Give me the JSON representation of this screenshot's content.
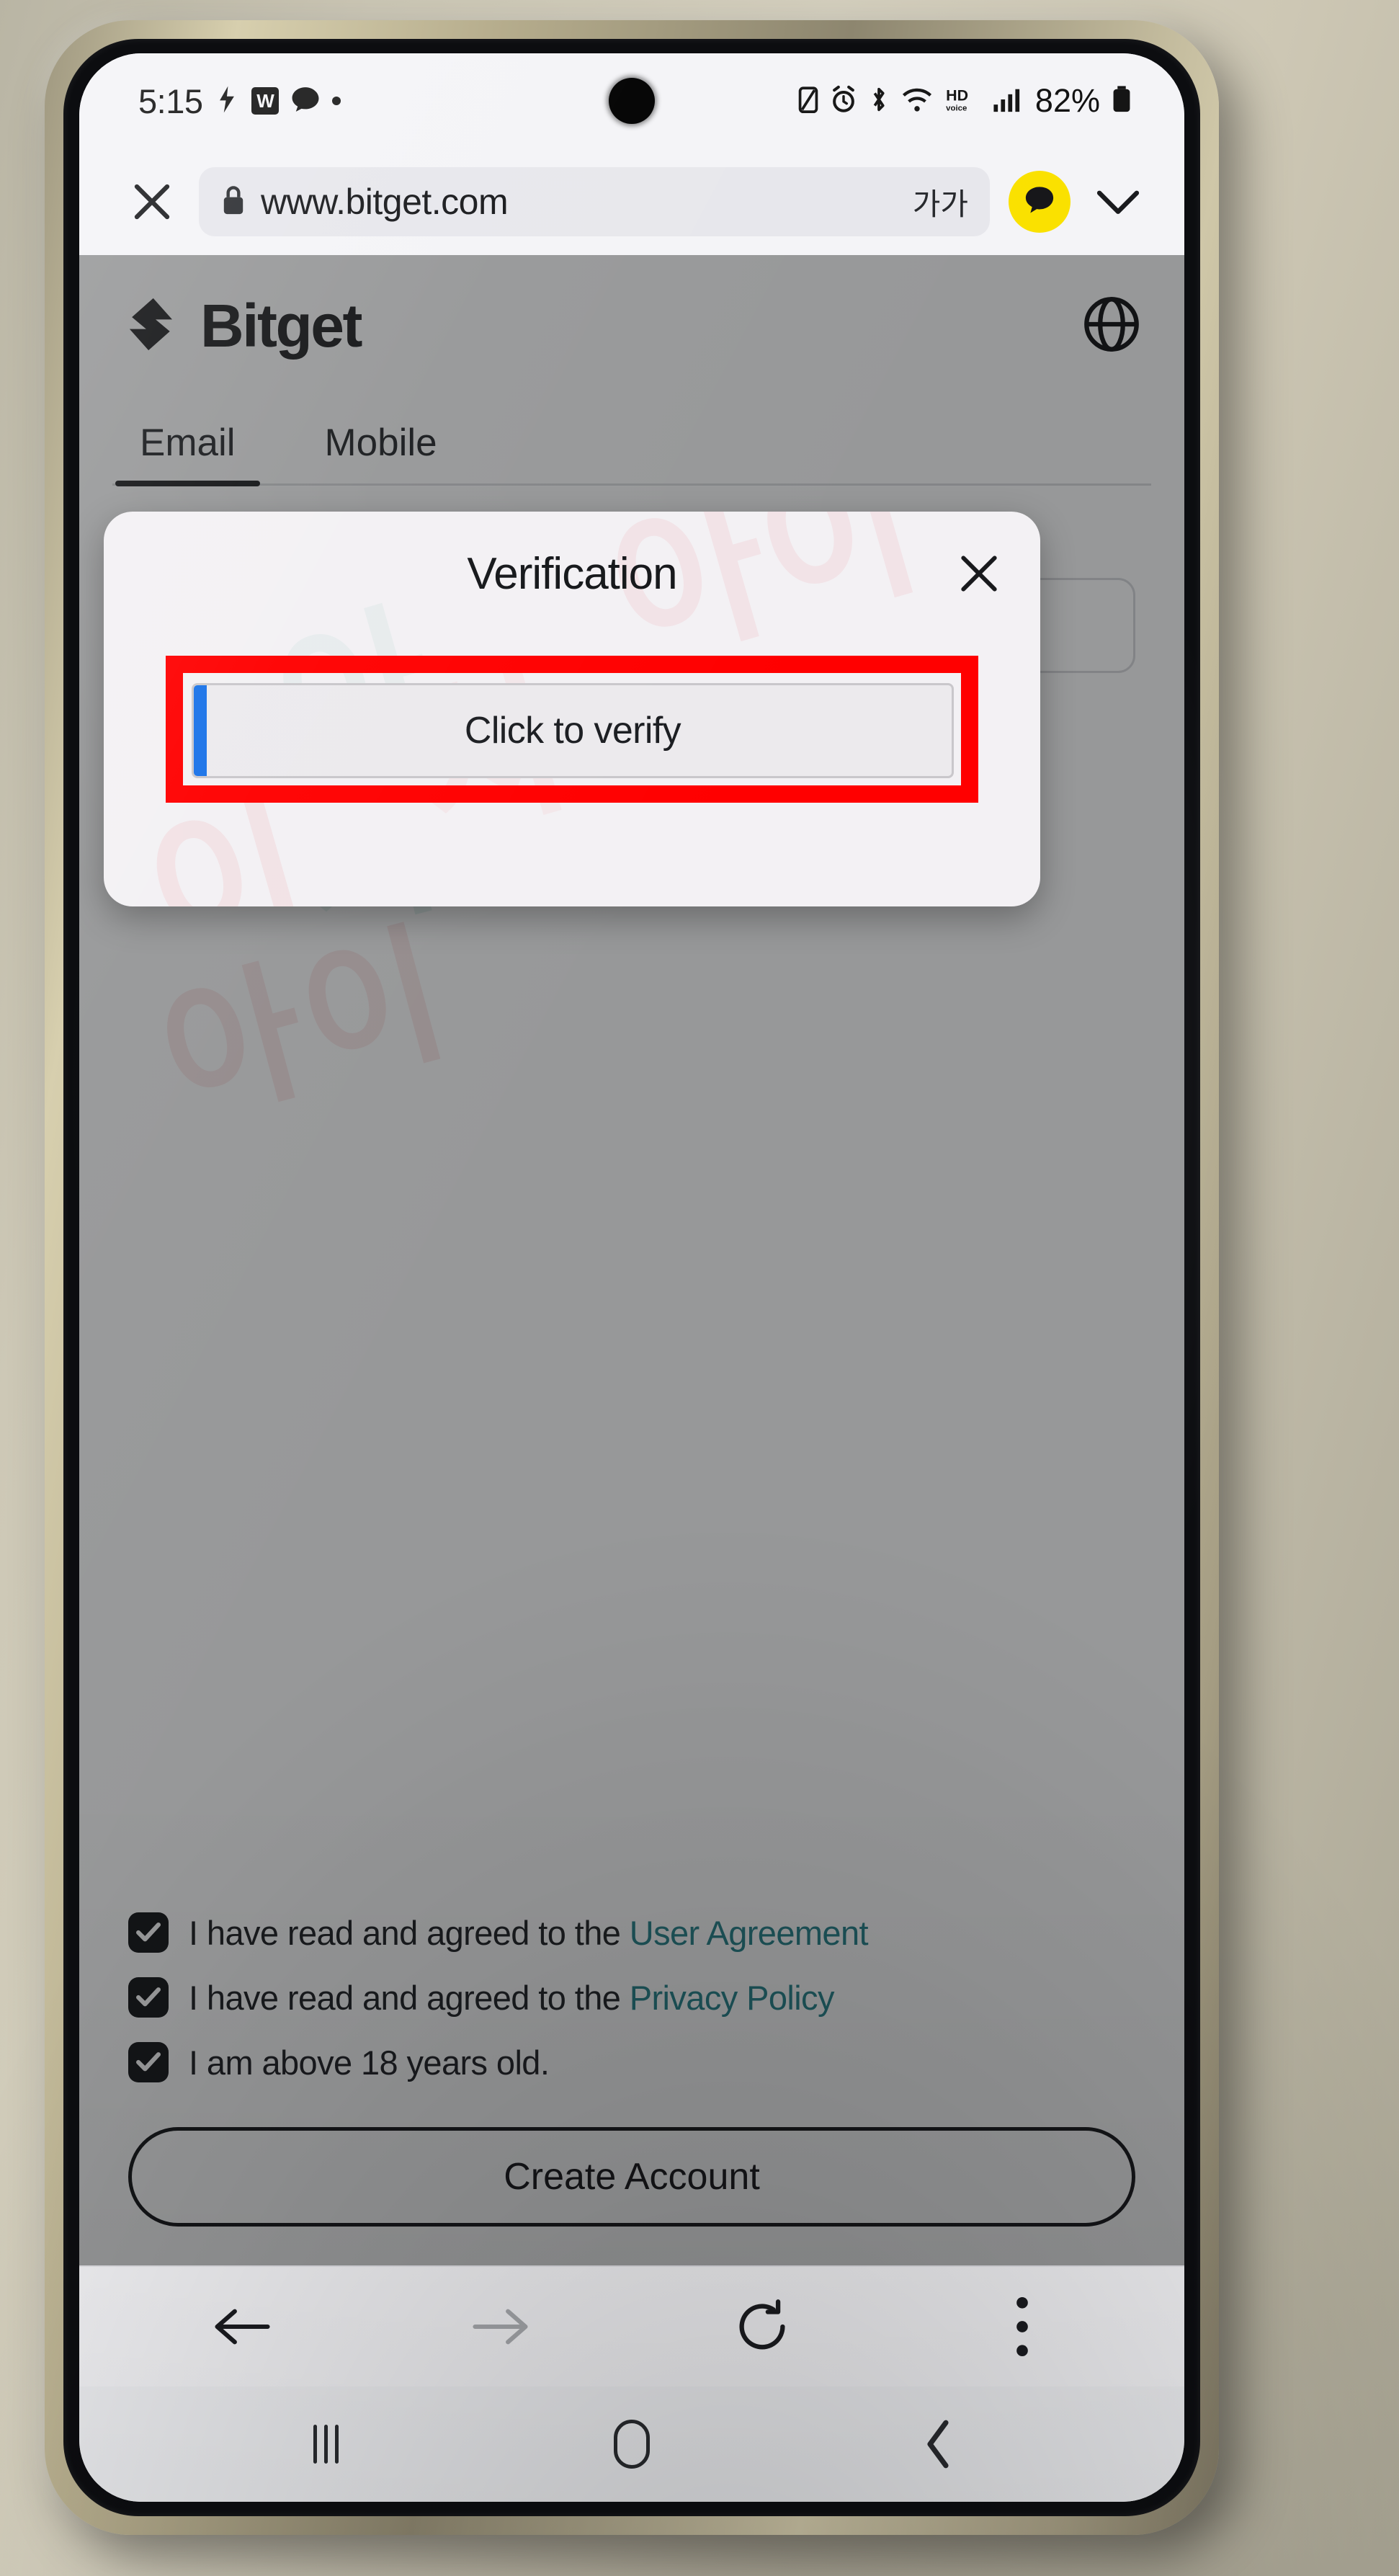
{
  "status_bar": {
    "time": "5:15",
    "battery_percent": "82%",
    "left_icons": [
      "vibrate-icon",
      "wikipedia-badge-icon",
      "chat-bubble-icon",
      "dot-indicator-icon"
    ],
    "right_icons": [
      "mute-battery-icon",
      "alarm-icon",
      "bluetooth-icon",
      "wifi-icon",
      "hd-voice-icon",
      "signal-bars-icon",
      "battery-icon"
    ]
  },
  "browser": {
    "url": "www.bitget.com",
    "lock_icon": "lock-icon",
    "close_label": "close-tab-icon",
    "font_size_label": "가가",
    "kakao_icon": "kakaotalk-icon",
    "chevron_icon": "chevron-down-icon",
    "toolbar": {
      "back": "back-arrow-icon",
      "forward": "forward-arrow-icon",
      "reload": "reload-icon",
      "menu": "more-options-icon"
    }
  },
  "android_nav": {
    "recents": "recents-icon",
    "home": "home-icon",
    "back": "back-icon"
  },
  "page": {
    "brand": "Bitget",
    "language_icon": "globe-icon",
    "tabs": [
      {
        "label": "Email",
        "active": true
      },
      {
        "label": "Mobile",
        "active": false
      }
    ],
    "email_label": "Email",
    "email_value": "",
    "consents": [
      {
        "text_before": "I have read and agreed to the ",
        "link": "User Agreement",
        "checked": true
      },
      {
        "text_before": "I have read and agreed to the ",
        "link": "Privacy Policy",
        "checked": true
      },
      {
        "text_before": "I am above 18 years old.",
        "link": "",
        "checked": true
      }
    ],
    "submit_label": "Create Account",
    "watermarks": [
      "아이",
      "차이",
      "아이"
    ]
  },
  "modal": {
    "title": "Verification",
    "close_icon": "close-icon",
    "slider_label": "Click to verify",
    "highlight_color": "#FF0000",
    "handle_color": "#1A73E8",
    "watermarks": [
      "아이",
      "차",
      "이",
      "아"
    ]
  },
  "colors": {
    "accent_red": "#FF0000",
    "link_teal": "#1D7E86",
    "kakao_yellow": "#FAE100",
    "slider_blue": "#1A73E8",
    "ink": "#0C0D10"
  }
}
